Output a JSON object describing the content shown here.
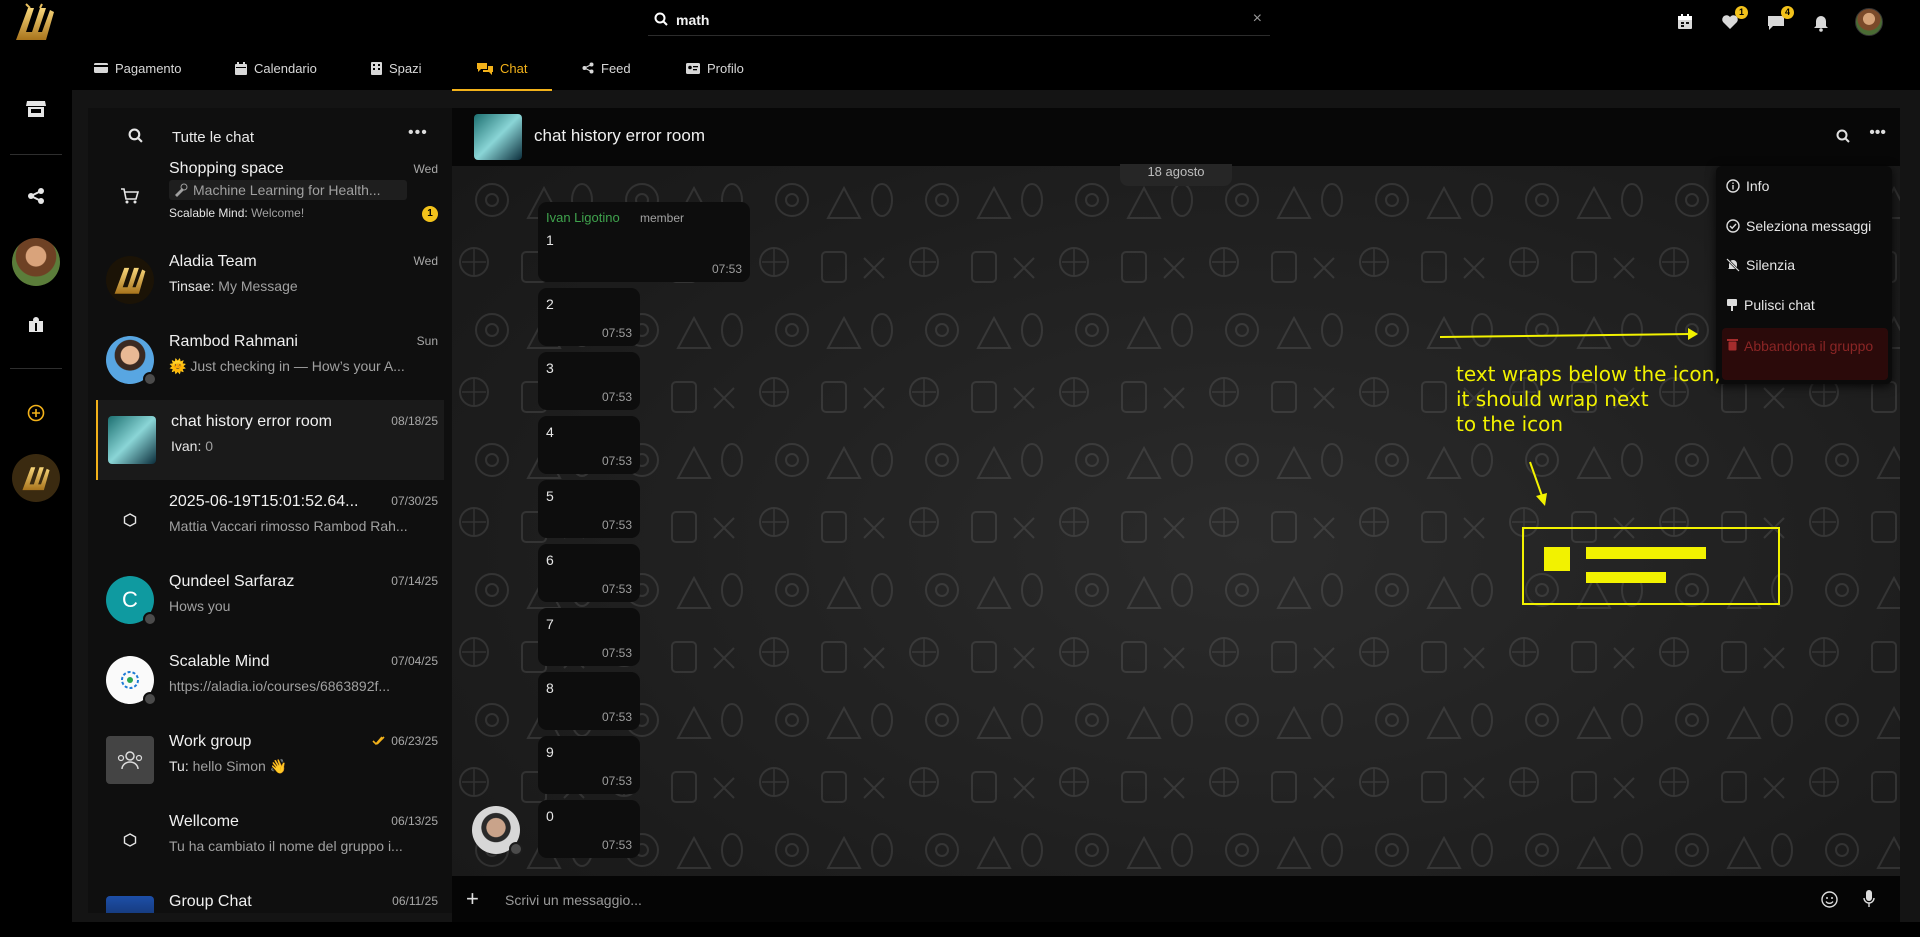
{
  "search": {
    "value": "math",
    "clear": "×"
  },
  "topbar": {
    "icons": [
      "calendar-icon",
      "heart-icon",
      "chat-icon",
      "bell-icon"
    ],
    "heart_badge": "1",
    "chat_badge": "4"
  },
  "tabs": [
    {
      "label": "Pagamento",
      "icon": "card-icon"
    },
    {
      "label": "Calendario",
      "icon": "calendar-icon"
    },
    {
      "label": "Spazi",
      "icon": "building-icon"
    },
    {
      "label": "Chat",
      "icon": "chat-icon",
      "active": true
    },
    {
      "label": "Feed",
      "icon": "share-icon"
    },
    {
      "label": "Profilo",
      "icon": "id-card-icon"
    }
  ],
  "rail": {
    "items": [
      "store-icon",
      "share-icon",
      "user-avatar",
      "books-icon",
      "add-icon",
      "aladia-logo"
    ]
  },
  "chat_list": {
    "title": "Tutte le chat",
    "more": "•••",
    "items": [
      {
        "name": "Shopping space",
        "date": "Wed",
        "sub_pinned": "Machine Learning for Health...",
        "sub_sender": "Scalable Mind:",
        "sub_text": "Welcome!",
        "badge": "1"
      },
      {
        "name": "Aladia Team",
        "date": "Wed",
        "sub_sender": "Tinsae:",
        "sub_text": "My Message"
      },
      {
        "name": "Rambod Rahmani",
        "date": "Sun",
        "sub_text": "🌞 Just checking in — How’s your A..."
      },
      {
        "name": "chat history error room",
        "date": "08/18/25",
        "sub_sender": "Ivan:",
        "sub_text": "0",
        "selected": true
      },
      {
        "name": "2025-06-19T15:01:52.64...",
        "date": "07/30/25",
        "sub_text": "Mattia Vaccari rimosso Rambod Rah..."
      },
      {
        "name": "Qundeel Sarfaraz",
        "date": "07/14/25",
        "sub_text": "Hows you",
        "initial": "C"
      },
      {
        "name": "Scalable Mind",
        "date": "07/04/25",
        "sub_text": "https://aladia.io/courses/6863892f..."
      },
      {
        "name": "Work group",
        "date": "06/23/25",
        "sub_sender": "Tu:",
        "sub_text": "hello Simon 👋"
      },
      {
        "name": "Wellcome",
        "date": "06/13/25",
        "sub_text": "Tu ha cambiato il nome del gruppo i..."
      },
      {
        "name": "Group Chat",
        "date": "06/11/25",
        "sub_text": ""
      }
    ]
  },
  "conversation": {
    "title": "chat history error room",
    "date_chip": "18 agosto",
    "messages": [
      {
        "author": "Ivan Ligotino",
        "role": "member",
        "text": "1",
        "time": "07:53"
      },
      {
        "text": "2",
        "time": "07:53"
      },
      {
        "text": "3",
        "time": "07:53"
      },
      {
        "text": "4",
        "time": "07:53"
      },
      {
        "text": "5",
        "time": "07:53"
      },
      {
        "text": "6",
        "time": "07:53"
      },
      {
        "text": "7",
        "time": "07:53"
      },
      {
        "text": "8",
        "time": "07:53"
      },
      {
        "text": "9",
        "time": "07:53"
      },
      {
        "text": "0",
        "time": "07:53"
      }
    ]
  },
  "menu": {
    "items": [
      {
        "label": "Info",
        "icon": "info-icon"
      },
      {
        "label": "Seleziona messaggi",
        "icon": "check-circle-icon"
      },
      {
        "label": "Silenzia",
        "icon": "bell-off-icon"
      },
      {
        "label": "Pulisci chat",
        "icon": "broom-icon"
      }
    ],
    "danger_label": "Abbandona il gruppo"
  },
  "annotation": {
    "lines": [
      "text wraps below the icon,",
      "it should wrap next",
      "to the icon"
    ],
    "color": "#f2f200"
  },
  "composer": {
    "placeholder": "Scrivi un messaggio..."
  },
  "colors": {
    "accent": "#f3b21a",
    "danger": "#8a2525",
    "author": "#3fa34d"
  }
}
